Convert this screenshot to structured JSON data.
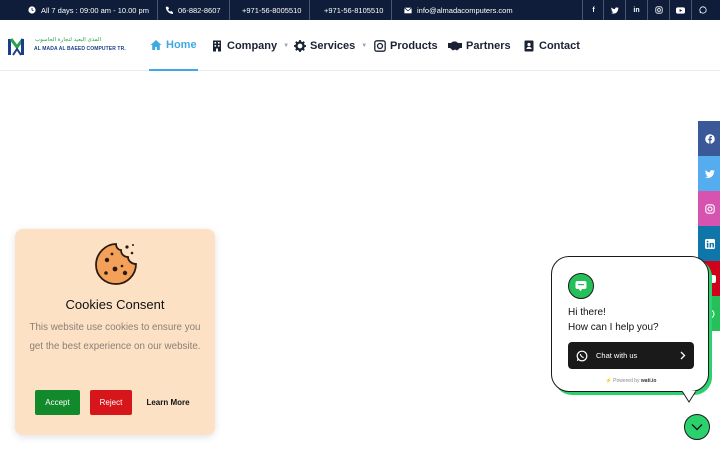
{
  "topbar": {
    "hours": "All 7 days : 09:00 am - 10.00 pm",
    "phone1": "06-882-8607",
    "phone2": "+971-56-8005510",
    "phone3": "+971-56-8105510",
    "email": "info@almadacomputers.com",
    "social": [
      "facebook-icon",
      "twitter-icon",
      "linkedin-icon",
      "instagram-icon",
      "youtube-icon",
      "whatsapp-icon"
    ]
  },
  "logo": {
    "arabic": "المدى البعيد لتجارة الحاسوب",
    "english": "AL MADA AL BAEED COMPUTER TR."
  },
  "nav": {
    "home": "Home",
    "company": "Company",
    "services": "Services",
    "products": "Products",
    "partners": "Partners",
    "contact": "Contact"
  },
  "side_social": {
    "items": [
      "facebook-icon",
      "twitter-icon",
      "instagram-icon",
      "linkedin-icon",
      "youtube-icon",
      "whatsapp-icon"
    ],
    "colors": [
      "#3b5998",
      "#55acee",
      "#d653b0",
      "#0e76a8",
      "#d0021b",
      "#25c05a"
    ]
  },
  "cookie": {
    "title": "Cookies Consent",
    "text": "This website use cookies to ensure you get the best experience on our website.",
    "accept": "Accept",
    "reject": "Reject",
    "learn_more": "Learn More"
  },
  "chat": {
    "line1": "Hi there!",
    "line2": "How can I help you?",
    "button": "Chat with us",
    "powered_prefix": "Powered by",
    "powered_brand": "wati.io"
  },
  "colors": {
    "topbar_bg": "#0f1d3a",
    "accent": "#3fa9e3",
    "cookie_bg": "#fce1c5",
    "accept": "#128a2b",
    "reject": "#d7161c",
    "chat_green": "#2ad16c"
  }
}
